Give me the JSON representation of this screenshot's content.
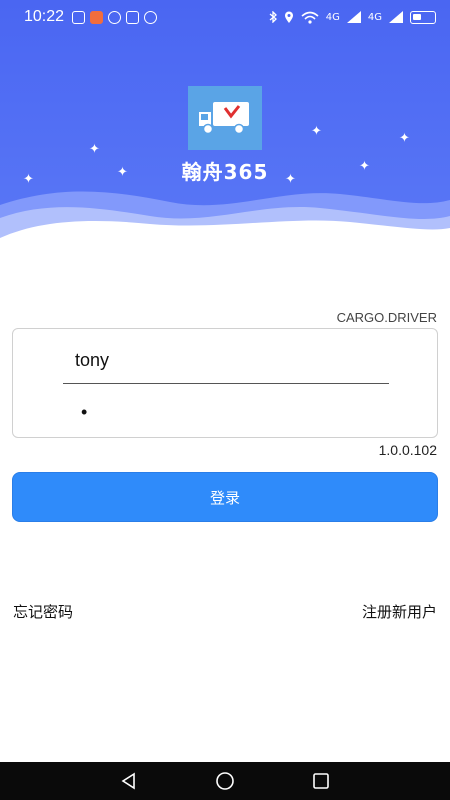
{
  "status_bar": {
    "time": "10:22",
    "network_1": "4G",
    "network_2": "4G",
    "left_icons": [
      "penguin-icon",
      "app-badge-icon",
      "eye-icon",
      "nfc-icon",
      "alarm-icon"
    ],
    "right_icons": [
      "bluetooth-icon",
      "location-icon",
      "wifi-icon",
      "signal-icon",
      "signal-icon",
      "battery-icon"
    ]
  },
  "app": {
    "logo": "truck-logo-icon",
    "title": "翰舟365"
  },
  "login": {
    "role_label": "CARGO.DRIVER",
    "username_value": "tony",
    "password_value": "•",
    "version": "1.0.0.102",
    "submit_label": "登录",
    "forgot_password": "忘记密码",
    "register": "注册新用户"
  },
  "nav": {
    "back": "back-triangle-icon",
    "home": "home-circle-icon",
    "recent": "recent-square-icon"
  },
  "colors": {
    "header_blue": "#4a66f2",
    "button_blue": "#2f8bfa",
    "logo_bg": "#5aa4e6"
  }
}
